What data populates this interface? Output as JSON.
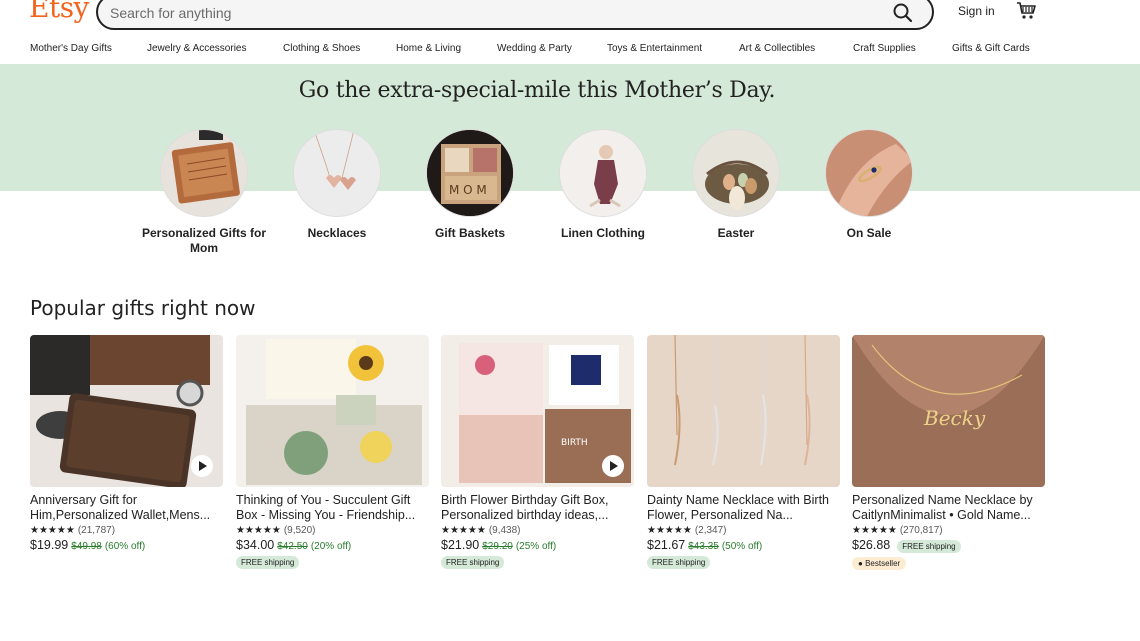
{
  "header": {
    "logo": "Etsy",
    "search_placeholder": "Search for anything",
    "sign_in": "Sign in",
    "icons": [
      "search-icon",
      "cart-icon"
    ]
  },
  "nav": {
    "items": [
      "Mother's Day Gifts",
      "Jewelry & Accessories",
      "Clothing & Shoes",
      "Home & Living",
      "Wedding & Party",
      "Toys & Entertainment",
      "Art & Collectibles",
      "Craft Supplies",
      "Gifts & Gift Cards"
    ]
  },
  "banner": {
    "title": "Go the extra-special-mile this Mother’s Day.",
    "categories": [
      {
        "label": "Personalized Gifts for Mom"
      },
      {
        "label": "Necklaces"
      },
      {
        "label": "Gift Baskets"
      },
      {
        "label": "Linen Clothing"
      },
      {
        "label": "Easter"
      },
      {
        "label": "On Sale"
      }
    ]
  },
  "popular": {
    "title": "Popular gifts right now",
    "products": [
      {
        "title": "Anniversary Gift for Him,Personalized Wallet,Mens...",
        "stars": "★★★★★",
        "reviews": "(21,787)",
        "price": "$19.99",
        "original": "$49.98",
        "discount": "(60% off)",
        "free_shipping": "",
        "bestseller": "",
        "video": true
      },
      {
        "title": "Thinking of You - Succulent Gift Box - Missing You - Friendship...",
        "stars": "★★★★★",
        "reviews": "(9,520)",
        "price": "$34.00",
        "original": "$42.50",
        "discount": "(20% off)",
        "free_shipping": "FREE shipping",
        "bestseller": "",
        "video": false
      },
      {
        "title": "Birth Flower Birthday Gift Box, Personalized birthday ideas,...",
        "stars": "★★★★★",
        "reviews": "(9,438)",
        "price": "$21.90",
        "original": "$29.20",
        "discount": "(25% off)",
        "free_shipping": "FREE shipping",
        "bestseller": "",
        "video": true
      },
      {
        "title": "Dainty Name Necklace with Birth Flower, Personalized Na...",
        "stars": "★★★★★",
        "reviews": "(2,347)",
        "price": "$21.67",
        "original": "$43.35",
        "discount": "(50% off)",
        "free_shipping": "FREE shipping",
        "bestseller": "",
        "video": false
      },
      {
        "title": "Personalized Name Necklace by CaitlynMinimalist • Gold Name...",
        "stars": "★★★★★",
        "reviews": "(270,817)",
        "price": "$26.88",
        "original": "",
        "discount": "",
        "free_shipping": "FREE shipping",
        "bestseller": "Bestseller",
        "video": false
      }
    ]
  },
  "colors": {
    "brand": "#f1641e",
    "banner_bg": "#d4e9d7",
    "discount_green": "#2a7d2e",
    "bestseller_bg": "#fdebd2"
  }
}
